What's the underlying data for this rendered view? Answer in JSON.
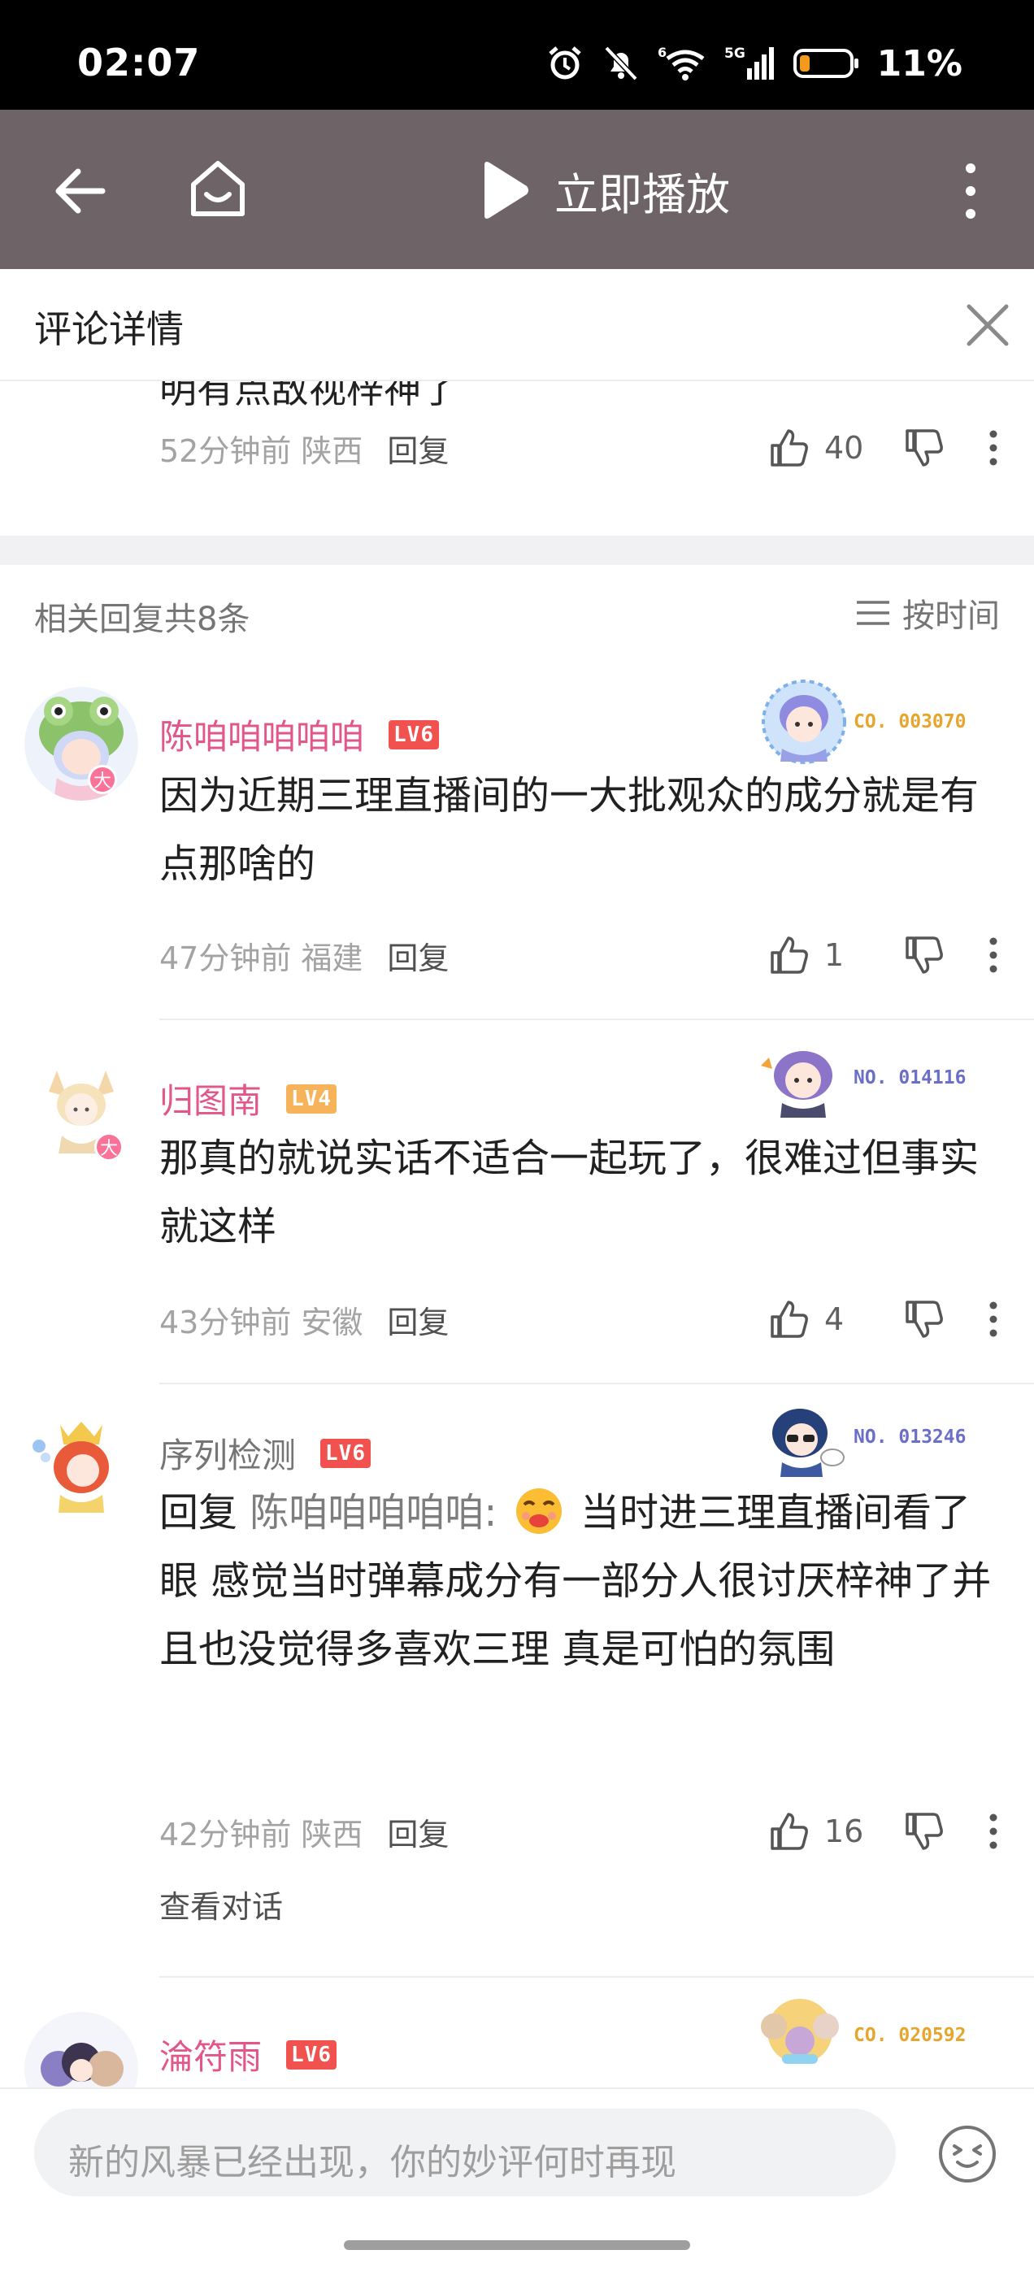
{
  "status_bar": {
    "time": "02:07",
    "battery": "11%",
    "signal_label": "5G",
    "wifi_label": "6"
  },
  "player_bar": {
    "play_label": "立即播放"
  },
  "detail_header": {
    "title": "评论详情"
  },
  "parent_comment": {
    "text_fragment": "明有点敌视梓神了",
    "time": "52分钟前",
    "location": "陕西",
    "reply_label": "回复",
    "likes": "40"
  },
  "replies_header": {
    "count_text": "相关回复共8条",
    "sort_label": "按时间"
  },
  "replies": [
    {
      "username": "陈咱咱咱咱咱",
      "level": "LV6",
      "fan_no": "CO. 003070",
      "text": "因为近期三理直播间的一大批观众的成分就是有点那啥的",
      "time": "47分钟前",
      "location": "福建",
      "reply_label": "回复",
      "likes": "1",
      "avatar_badge": "大"
    },
    {
      "username": "归图南",
      "level": "LV4",
      "fan_no": "NO. 014116",
      "text": "那真的就说实话不适合一起玩了，很难过但事实就这样",
      "time": "43分钟前",
      "location": "安徽",
      "reply_label": "回复",
      "likes": "4",
      "avatar_badge": "大"
    },
    {
      "username": "序列检测",
      "level": "LV6",
      "fan_no": "NO. 013246",
      "reply_prefix": "回复",
      "mention": "陈咱咱咱咱咱:",
      "text_line1": "当时进三理直播间",
      "text_rest": "看了眼 感觉当时弹幕成分有一部分人很讨厌梓神了并且也没觉得多喜欢三理 真是可怕的氛围",
      "time": "42分钟前",
      "location": "陕西",
      "reply_label": "回复",
      "likes": "16",
      "view_conversation": "查看对话"
    },
    {
      "username": "淪符雨",
      "level": "LV6",
      "fan_no": "CO. 020592"
    }
  ],
  "input": {
    "placeholder": "新的风暴已经出现，你的妙评何时再现"
  },
  "colors": {
    "pink_name": "#e2578a",
    "gray_name": "#757575",
    "lv6": "#f1524f",
    "lv4": "#f6b35a",
    "player_bg": "#6e6367",
    "fan_gold": "#e6a52c",
    "fan_purple": "#6b6fc7"
  }
}
